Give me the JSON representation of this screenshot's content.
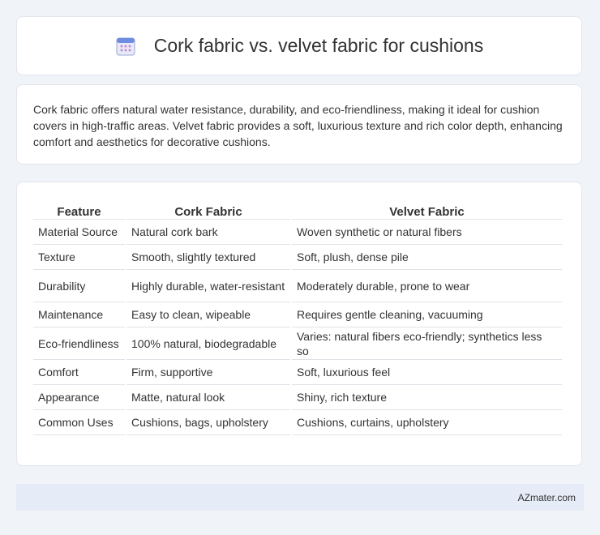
{
  "header": {
    "title": "Cork fabric vs. velvet fabric for cushions",
    "icon": "calendar-icon"
  },
  "intro": {
    "text": "Cork fabric offers natural water resistance, durability, and eco-friendliness, making it ideal for cushion covers in high-traffic areas. Velvet fabric provides a soft, luxurious texture and rich color depth, enhancing comfort and aesthetics for decorative cushions."
  },
  "table": {
    "headers": [
      "Feature",
      "Cork Fabric",
      "Velvet Fabric"
    ],
    "rows": [
      [
        "Material Source",
        "Natural cork bark",
        "Woven synthetic or natural fibers"
      ],
      [
        "Texture",
        "Smooth, slightly textured",
        "Soft, plush, dense pile"
      ],
      [
        "Durability",
        "Highly durable, water-resistant",
        "Moderately durable, prone to wear"
      ],
      [
        "Maintenance",
        "Easy to clean, wipeable",
        "Requires gentle cleaning, vacuuming"
      ],
      [
        "Eco-friendliness",
        "100% natural, biodegradable",
        "Varies: natural fibers eco-friendly; synthetics less so"
      ],
      [
        "Comfort",
        "Firm, supportive",
        "Soft, luxurious feel"
      ],
      [
        "Appearance",
        "Matte, natural look",
        "Shiny, rich texture"
      ],
      [
        "Common Uses",
        "Cushions, bags, upholstery",
        "Cushions, curtains, upholstery"
      ]
    ]
  },
  "footer": {
    "brand": "AZmater.com"
  }
}
